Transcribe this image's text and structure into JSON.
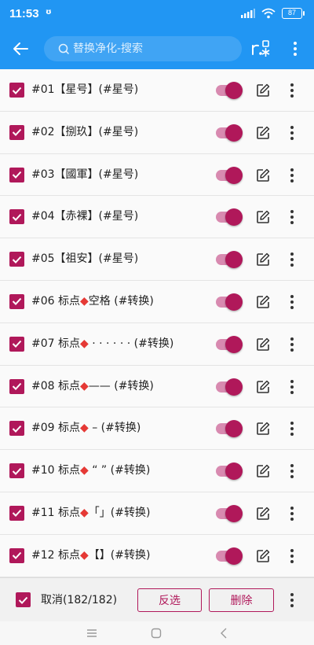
{
  "status_bar": {
    "time": "11:53",
    "extra_icon": "notification-icon",
    "battery": "87"
  },
  "app_bar": {
    "back_icon": "arrow-left-icon",
    "search_placeholder": "替换净化-搜索",
    "regex_icon": "regex-icon",
    "more_icon": "more-vertical-icon"
  },
  "rules": [
    {
      "label": "#01【星号】(#星号)",
      "checked": true,
      "enabled": true
    },
    {
      "label": "#02【捌玖】(#星号)",
      "checked": true,
      "enabled": true
    },
    {
      "label": "#03【國軍】(#星号)",
      "checked": true,
      "enabled": true
    },
    {
      "label": "#04【赤裸】(#星号)",
      "checked": true,
      "enabled": true
    },
    {
      "label": "#05【祖安】(#星号)",
      "checked": true,
      "enabled": true
    },
    {
      "label": "#06 标点◆空格 (#转换)",
      "checked": true,
      "enabled": true
    },
    {
      "label": "#07 标点◆ · · · · · · (#转换)",
      "checked": true,
      "enabled": true
    },
    {
      "label": "#08 标点◆—— (#转换)",
      "checked": true,
      "enabled": true
    },
    {
      "label": "#09 标点◆ – (#转换)",
      "checked": true,
      "enabled": true
    },
    {
      "label": "#10 标点◆ “ ” (#转换)",
      "checked": true,
      "enabled": true
    },
    {
      "label": "#11 标点◆「」(#转换)",
      "checked": true,
      "enabled": true
    },
    {
      "label": "#12 标点◆【】(#转换)",
      "checked": true,
      "enabled": true
    }
  ],
  "bottom_bar": {
    "select_label": "取消(182/182)",
    "invert_label": "反选",
    "delete_label": "删除"
  },
  "colors": {
    "accent": "#b0185a",
    "toolbar": "#2196f3"
  }
}
